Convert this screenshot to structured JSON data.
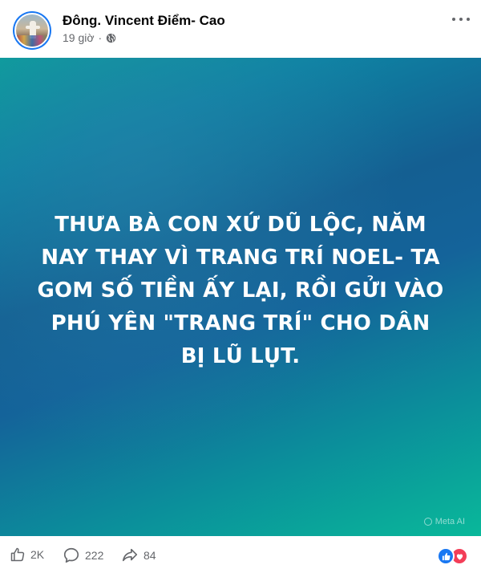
{
  "post": {
    "author": "Đông. Vincent Điểm- Cao",
    "time": "19 giờ",
    "separator": "·",
    "privacy_icon": "globe-icon",
    "menu_icon": "more-horizontal-icon"
  },
  "image": {
    "text": "THƯA BÀ CON XỨ DŨ LỘC, NĂM\nNAY THAY VÌ TRANG TRÍ NOEL- TA\nGOM SỐ TIỀN ẤY LẠI,  RỒI GỬI VÀO\nPHÚ YÊN \"TRANG TRÍ\" CHO DÂN\nBỊ LŨ LỤT.",
    "watermark": "Meta AI",
    "background_colors": [
      "#0aa19a",
      "#145f92",
      "#09b89a"
    ]
  },
  "actions": {
    "like_count": "2K",
    "comment_count": "222",
    "share_count": "84",
    "like_icon": "thumbs-up-icon",
    "comment_icon": "comment-icon",
    "share_icon": "share-icon"
  },
  "reactions": {
    "like_color": "#1877f2",
    "love_color": "#f33e58"
  }
}
